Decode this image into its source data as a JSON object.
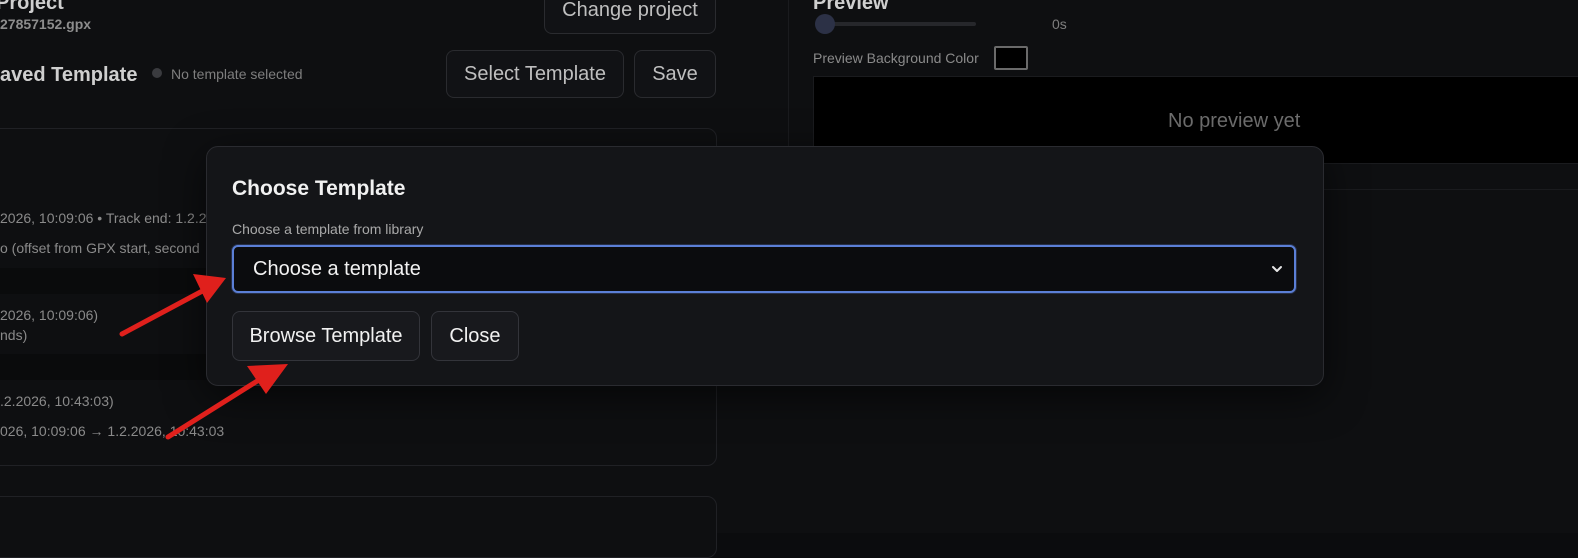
{
  "project": {
    "title": "Project",
    "file": "27857152.gpx",
    "change_label": "Change project"
  },
  "template_bar": {
    "label": "aved Template",
    "status": "No template selected",
    "select_label": "Select Template",
    "save_label": "Save"
  },
  "background_lines": [
    "2026, 10:09:06 • Track end: 1.2.2",
    "o (offset from GPX start, second",
    "2026, 10:09:06)",
    "nds)",
    ".2.2026, 10:43:03)",
    "026, 10:09:06 → 1.2.2026, 10:43:03"
  ],
  "preview": {
    "title": "Preview",
    "time": "0s",
    "bg_color_label": "Preview Background Color",
    "bg_color": "#000000",
    "empty_text": "No preview yet"
  },
  "modal": {
    "title": "Choose Template",
    "field_label": "Choose a template from library",
    "select_value": "Choose a template",
    "browse_label": "Browse Template",
    "close_label": "Close"
  },
  "colors": {
    "focus_border": "#5b7fd6",
    "arrow": "#e0201c"
  }
}
